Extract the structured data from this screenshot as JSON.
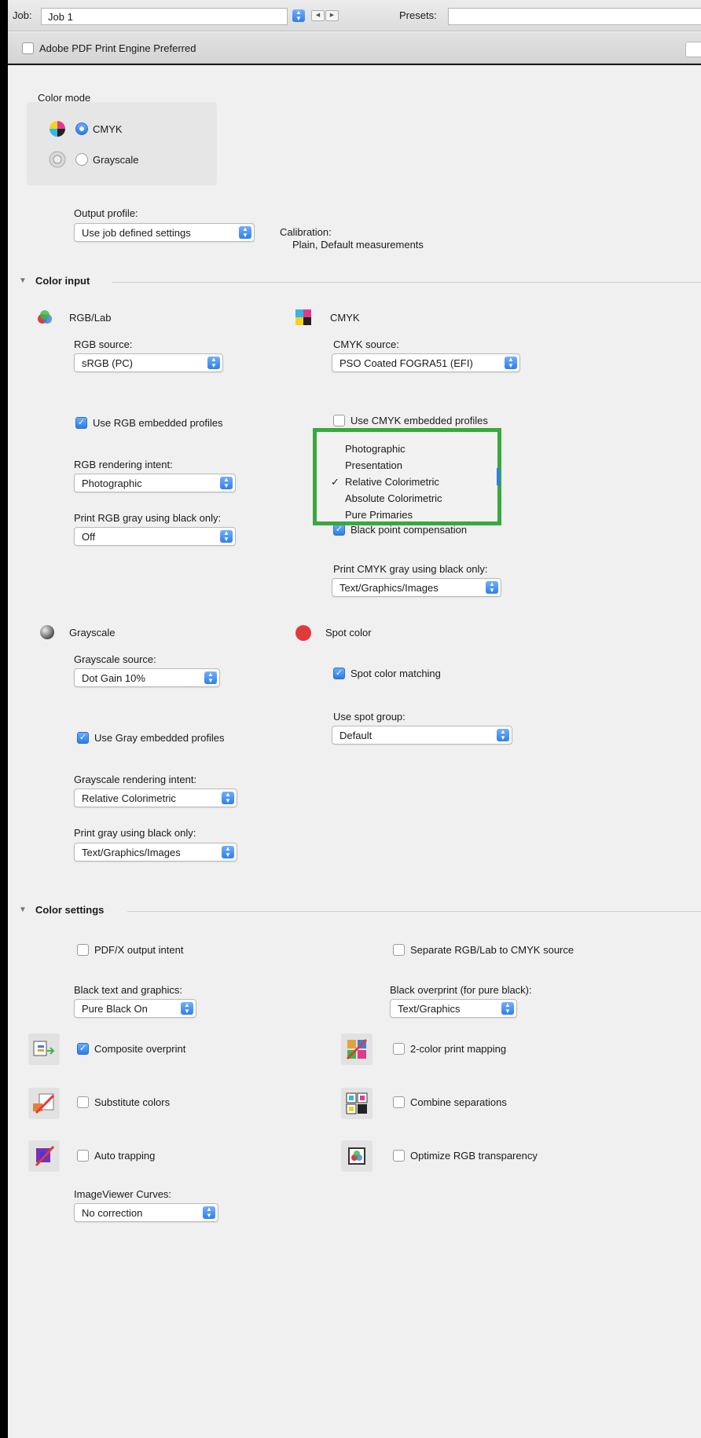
{
  "toolbar": {
    "job_label": "Job:",
    "job_value": "Job 1",
    "presets_label": "Presets:",
    "presets_value": ""
  },
  "subbar": {
    "adobe_pdf_label": "Adobe PDF Print Engine Preferred",
    "adobe_pdf_checked": false
  },
  "color_mode": {
    "heading": "Color mode",
    "options": [
      {
        "label": "CMYK",
        "selected": true
      },
      {
        "label": "Grayscale",
        "selected": false
      }
    ]
  },
  "output": {
    "profile_label": "Output profile:",
    "profile_value": "Use job defined settings",
    "calibration_label": "Calibration:",
    "calibration_value": "Plain, Default measurements"
  },
  "color_input": {
    "title": "Color input",
    "rgb": {
      "heading": "RGB/Lab",
      "source_label": "RGB source:",
      "source_value": "sRGB (PC)",
      "embedded_label": "Use RGB embedded profiles",
      "embedded_checked": true,
      "intent_label": "RGB rendering intent:",
      "intent_value": "Photographic",
      "gray_label": "Print RGB gray using black only:",
      "gray_value": "Off"
    },
    "cmyk": {
      "heading": "CMYK",
      "source_label": "CMYK source:",
      "source_value": "PSO Coated FOGRA51 (EFI)",
      "embedded_label": "Use CMYK embedded profiles",
      "embedded_checked": false,
      "intent_menu": {
        "items": [
          "Photographic",
          "Presentation",
          "Relative Colorimetric",
          "Absolute Colorimetric",
          "Pure Primaries"
        ],
        "checked_index": 2,
        "check_mark": "✓"
      },
      "bpc_label": "Black point compensation",
      "bpc_checked": true,
      "gray_label": "Print CMYK gray using black only:",
      "gray_value": "Text/Graphics/Images"
    },
    "grayscale": {
      "heading": "Grayscale",
      "source_label": "Grayscale source:",
      "source_value": "Dot Gain 10%",
      "embedded_label": "Use Gray embedded profiles",
      "embedded_checked": true,
      "intent_label": "Grayscale rendering intent:",
      "intent_value": "Relative Colorimetric",
      "gray_label": "Print gray using black only:",
      "gray_value": "Text/Graphics/Images"
    },
    "spot": {
      "heading": "Spot color",
      "matching_label": "Spot color matching",
      "matching_checked": true,
      "group_label": "Use spot group:",
      "group_value": "Default"
    }
  },
  "color_settings": {
    "title": "Color settings",
    "pdfx_label": "PDF/X output intent",
    "pdfx_checked": false,
    "separate_label": "Separate RGB/Lab to CMYK source",
    "separate_checked": false,
    "black_text_label": "Black text and graphics:",
    "black_text_value": "Pure Black On",
    "black_overprint_label": "Black overprint (for pure black):",
    "black_overprint_value": "Text/Graphics",
    "composite_label": "Composite overprint",
    "composite_checked": true,
    "two_color_label": "2-color print mapping",
    "two_color_checked": false,
    "substitute_label": "Substitute colors",
    "substitute_checked": false,
    "combine_label": "Combine separations",
    "combine_checked": false,
    "trapping_label": "Auto trapping",
    "trapping_checked": false,
    "optimize_label": "Optimize RGB transparency",
    "optimize_checked": false,
    "curves_label": "ImageViewer Curves:",
    "curves_value": "No correction"
  },
  "colors": {
    "accent": "#2f7fe8",
    "highlight_border": "#3aa83e",
    "spot_red": "#e23a3a"
  }
}
